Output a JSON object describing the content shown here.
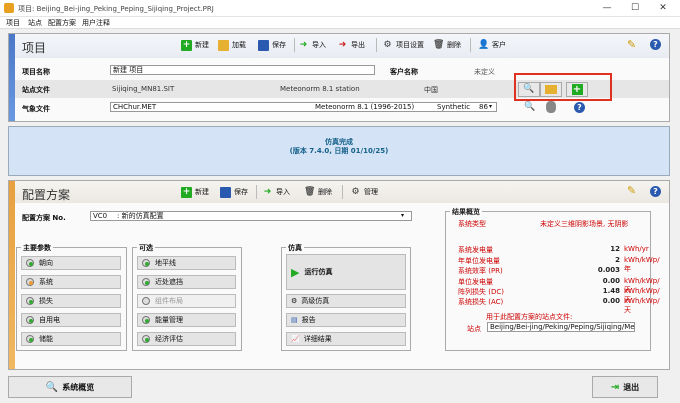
{
  "window": {
    "title": "项目: Beijing_Bei-jing_Peking_Peping_Sijiqing_Project.PRJ",
    "min": "—",
    "max": "☐",
    "close": "✕"
  },
  "menu": [
    "项目",
    "站点",
    "配置方案",
    "用户注释"
  ],
  "project": {
    "title": "项目",
    "toolbar": {
      "new": "新建",
      "load": "加载",
      "save": "保存",
      "import": "导入",
      "export": "导出",
      "settings": "项目设置",
      "delete": "删除",
      "client": "客户"
    },
    "name_label": "项目名称",
    "name_value": "新建 项目",
    "client_label": "客户名称",
    "client_value": "未定义",
    "site_label": "站点文件",
    "site_file": "Sijiqing_MN81.SIT",
    "site_source": "Meteonorm 8.1 station",
    "site_country": "中国",
    "meteo_label": "气象文件",
    "meteo_file": "CHChur.MET",
    "meteo_source": "Meteonorm 8.1 (1996-2015)",
    "meteo_type": "Synthetic",
    "meteo_num": "86"
  },
  "banner": {
    "line1": "仿真完成",
    "line2": "(版本 7.4.0, 日期 01/10/25)"
  },
  "variant": {
    "title": "配置方案",
    "toolbar": {
      "new": "新建",
      "save": "保存",
      "import": "导入",
      "delete": "删除",
      "manage": "管理"
    },
    "label": "配置方案 No.",
    "code": "VC0",
    "desc": ": 新的仿真配置",
    "main_params": {
      "title": "主要参数",
      "items": [
        "朝向",
        "系统",
        "损失",
        "自用电",
        "储能"
      ]
    },
    "optional": {
      "title": "可选",
      "items": [
        "地平线",
        "近处遮挡",
        "组件布局",
        "能量管理",
        "经济评估"
      ]
    },
    "sim": {
      "title": "仿真",
      "run": "运行仿真",
      "advanced": "高级仿真",
      "report": "报告",
      "details": "详细结果"
    }
  },
  "results": {
    "title": "结果概览",
    "system_type_label": "系统类型",
    "system_type_value": "未定义三维阴影场景, 无阴影",
    "rows": [
      {
        "k": "系统发电量",
        "v": "12",
        "u": "kWh/yr"
      },
      {
        "k": "年单位发电量",
        "v": "2",
        "u": "kWh/kWp/年"
      },
      {
        "k": "系统效率 (PR)",
        "v": "0.003",
        "u": ""
      },
      {
        "k": "单位发电量",
        "v": "0.00",
        "u": "kWh/kWp/天"
      },
      {
        "k": "阵列损失 (DC)",
        "v": "1.48",
        "u": "kWh/kWp/天"
      },
      {
        "k": "系统损失 (AC)",
        "v": "0.00",
        "u": "kWh/kWp/天"
      }
    ],
    "site_note": "用于此配置方案的站点文件:",
    "site_label": "站点",
    "site_value": "Beijing/Bei-jing/Peking/Peping/Sijiqing/MeteoNorm 8.1 ("
  },
  "bottom": {
    "overview": "系统概览",
    "exit": "退出"
  },
  "colors": {
    "accent": "#4a78c8",
    "orange": "#e8a040",
    "banner_bg": "#d4e4f6",
    "highlight": "#e03020"
  }
}
